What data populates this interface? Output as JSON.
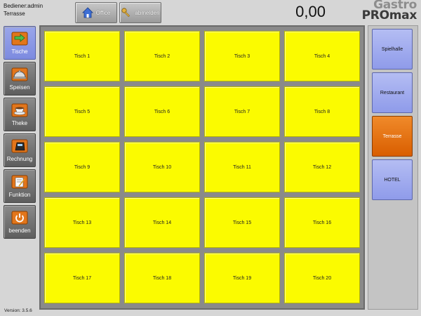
{
  "header": {
    "user_line": "Bediener:admin",
    "area_line": "Terrasse",
    "office_label": "Office",
    "logout_label": "abmelden",
    "total": "0,00",
    "logo_line1": "Gastro",
    "logo_line2": "PROmax"
  },
  "sidebar": {
    "items": [
      {
        "label": "Tische"
      },
      {
        "label": "Speisen"
      },
      {
        "label": "Theke"
      },
      {
        "label": "Rechnung"
      },
      {
        "label": "Funktion"
      },
      {
        "label": "beenden"
      }
    ]
  },
  "tables": [
    "Tisch 1",
    "Tisch 2",
    "Tisch 3",
    "Tisch 4",
    "Tisch 5",
    "Tisch 6",
    "Tisch 7",
    "Tisch 8",
    "Tisch 9",
    "Tisch 10",
    "Tisch 11",
    "Tisch 12",
    "Tisch 13",
    "Tisch 14",
    "Tisch 15",
    "Tisch 16",
    "Tisch 17",
    "Tisch 18",
    "Tisch 19",
    "Tisch 20"
  ],
  "areas": [
    {
      "label": "Spielhalle"
    },
    {
      "label": "Restaurant"
    },
    {
      "label": "Terrasse"
    },
    {
      "label": "HOTEL"
    }
  ],
  "version": "Version: 3.5.6",
  "colors": {
    "table_bg": "#fbfb00",
    "active_tab": "#8b97e6",
    "active_area": "#e06a10"
  }
}
